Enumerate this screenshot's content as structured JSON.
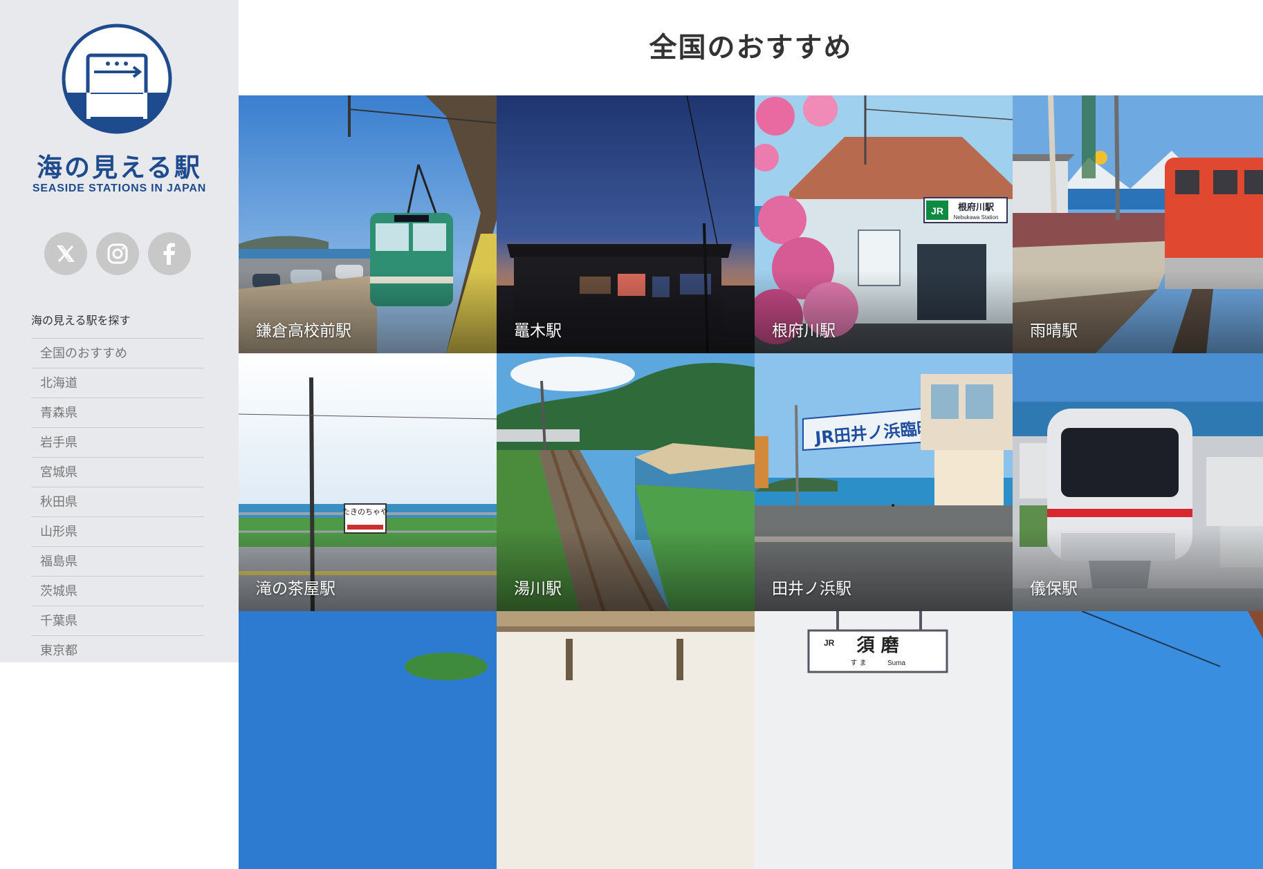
{
  "brand": {
    "title": "海の見える駅",
    "subtitle": "SEASIDE STATIONS IN JAPAN",
    "primary_color": "#1e4a8e"
  },
  "social": [
    {
      "name": "x-icon"
    },
    {
      "name": "instagram-icon"
    },
    {
      "name": "facebook-icon"
    }
  ],
  "sidebar": {
    "search_label": "海の見える駅を探す",
    "items": [
      "全国のおすすめ",
      "北海道",
      "青森県",
      "岩手県",
      "宮城県",
      "秋田県",
      "山形県",
      "福島県",
      "茨城県",
      "千葉県",
      "東京都"
    ]
  },
  "main": {
    "title": "全国のおすすめ",
    "stations": [
      {
        "name": "鎌倉高校前駅"
      },
      {
        "name": "鼉木駅"
      },
      {
        "name": "根府川駅"
      },
      {
        "name": "雨晴駅"
      },
      {
        "name": "滝の茶屋駅"
      },
      {
        "name": "湯川駅"
      },
      {
        "name": "田井ノ浜駅"
      },
      {
        "name": "儀保駅"
      }
    ],
    "partial_row": {
      "sign_text": "須 磨",
      "sign_reading": "す ま",
      "sign_roman": "Suma",
      "sign_jr": "JR"
    }
  },
  "photo_signs": {
    "nebukawa_jp": "根府川駅",
    "nebukawa_en": "Nebukawa Station",
    "jr": "JR",
    "tainohama_banner": "JR田井ノ浜臨時駅",
    "takinochaya": "たきのちゃや"
  }
}
